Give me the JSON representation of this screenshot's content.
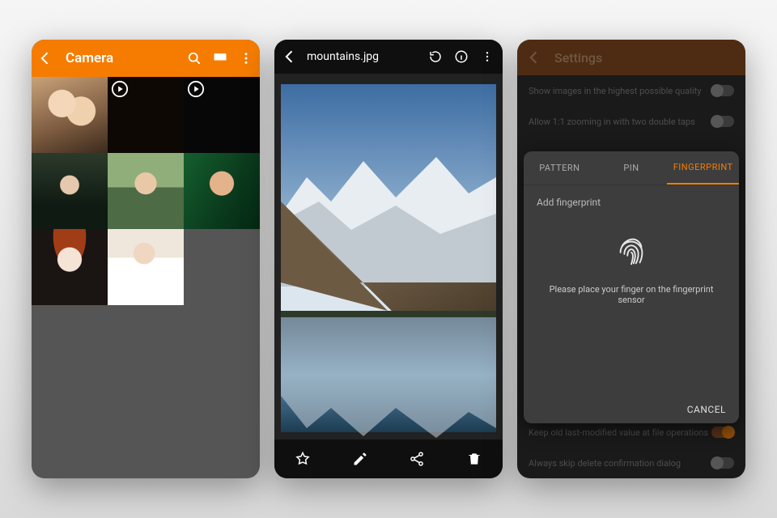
{
  "screen1": {
    "title": "Camera",
    "thumbs": [
      {
        "kind": "photo",
        "video": false
      },
      {
        "kind": "dark",
        "video": true
      },
      {
        "kind": "dark",
        "video": true
      },
      {
        "kind": "photo",
        "video": false
      },
      {
        "kind": "photo",
        "video": false
      },
      {
        "kind": "photo",
        "video": false
      },
      {
        "kind": "photo",
        "video": false
      },
      {
        "kind": "photo",
        "video": false
      }
    ]
  },
  "screen2": {
    "filename": "mountains.jpg"
  },
  "screen3": {
    "title": "Settings",
    "rows": {
      "r1": "Show images in the highest possible quality",
      "r2": "Allow 1:1 zooming in with two double taps",
      "r3": "Keep old last-modified value at file operations",
      "r4": "Always skip delete confirmation dialog"
    },
    "dialog": {
      "tabs": {
        "t1": "PATTERN",
        "t2": "PIN",
        "t3": "FINGERPRINT"
      },
      "subtitle": "Add fingerprint",
      "instruction": "Please place your finger on the fingerprint sensor",
      "cancel": "CANCEL"
    }
  }
}
